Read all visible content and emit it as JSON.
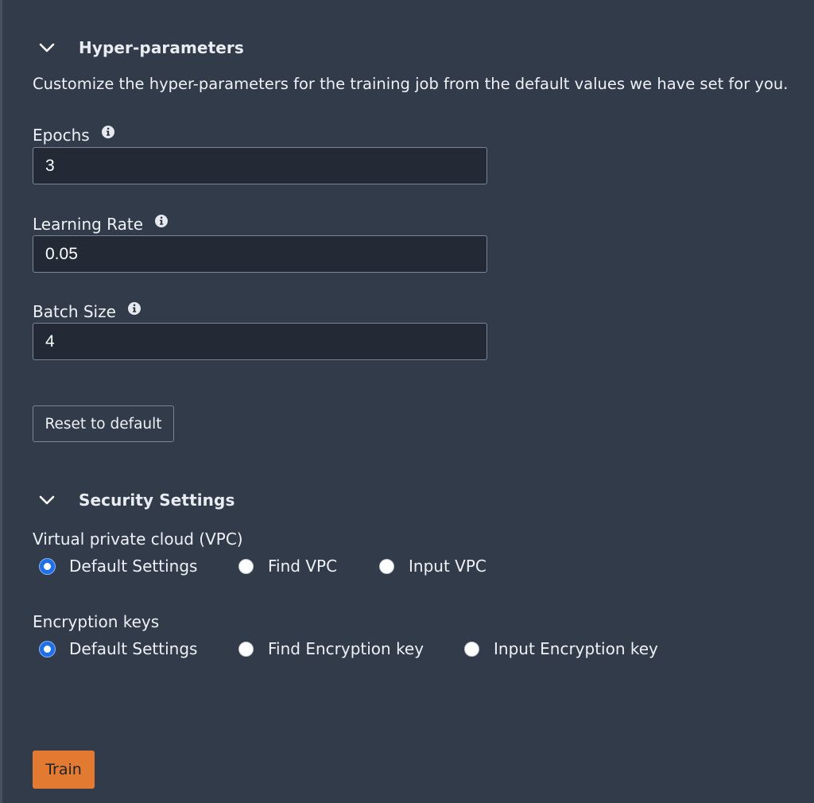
{
  "hyperparameters": {
    "title": "Hyper-parameters",
    "description": "Customize the hyper-parameters for the training job from the default values we have set for you.",
    "fields": [
      {
        "label": "Epochs",
        "value": "3"
      },
      {
        "label": "Learning Rate",
        "value": "0.05"
      },
      {
        "label": "Batch Size",
        "value": "4"
      }
    ],
    "reset_label": "Reset to default"
  },
  "security": {
    "title": "Security Settings",
    "vpc": {
      "label": "Virtual private cloud (VPC)",
      "options": [
        "Default Settings",
        "Find VPC",
        "Input VPC"
      ],
      "selected": "Default Settings"
    },
    "encryption": {
      "label": "Encryption keys",
      "options": [
        "Default Settings",
        "Find Encryption key",
        "Input Encryption key"
      ],
      "selected": "Default Settings"
    }
  },
  "train_label": "Train",
  "colors": {
    "background": "#323b4a",
    "input_background": "#232a35",
    "accent_orange": "#e27b31",
    "radio_selected": "#1f6fe8"
  },
  "icons": {
    "section_toggle": "chevron-down-icon",
    "field_help": "info-icon"
  }
}
